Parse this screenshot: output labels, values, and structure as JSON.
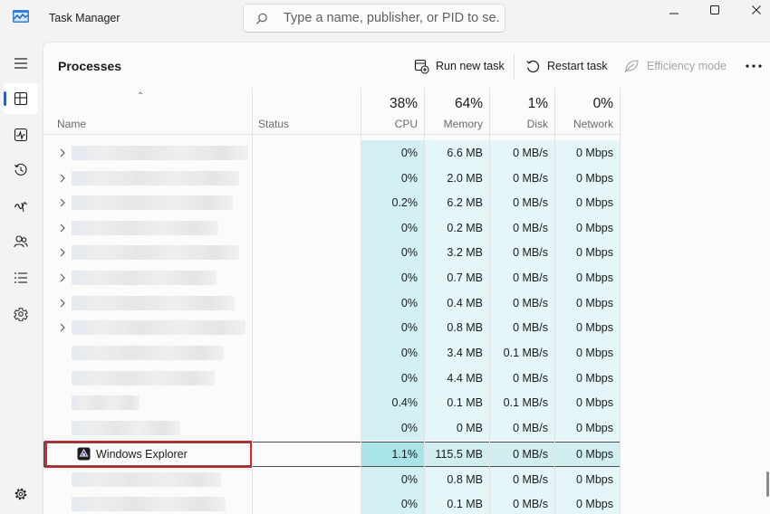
{
  "window": {
    "title": "Task Manager",
    "search_placeholder": "Type a name, publisher, or PID to se..."
  },
  "nav": [
    {
      "name": "hamburger-icon"
    },
    {
      "name": "processes-icon",
      "active": true
    },
    {
      "name": "performance-icon"
    },
    {
      "name": "app-history-icon"
    },
    {
      "name": "startup-apps-icon"
    },
    {
      "name": "users-icon"
    },
    {
      "name": "details-icon"
    },
    {
      "name": "services-icon"
    },
    {
      "name": "settings-icon"
    }
  ],
  "toolbar": {
    "page_title": "Processes",
    "run_new_task": "Run new task",
    "restart_task": "Restart task",
    "efficiency_mode": "Efficiency mode"
  },
  "columns": {
    "name": "Name",
    "status": "Status",
    "cpu_pct": "38%",
    "cpu": "CPU",
    "memory_pct": "64%",
    "memory": "Memory",
    "disk_pct": "1%",
    "disk": "Disk",
    "network_pct": "0%",
    "network": "Network"
  },
  "rows": [
    {
      "expandable": true,
      "cpu": "0%",
      "memory": "6.6 MB",
      "disk": "0 MB/s",
      "network": "0 Mbps"
    },
    {
      "expandable": true,
      "cpu": "0%",
      "memory": "2.0 MB",
      "disk": "0 MB/s",
      "network": "0 Mbps"
    },
    {
      "expandable": true,
      "cpu": "0.2%",
      "memory": "6.2 MB",
      "disk": "0 MB/s",
      "network": "0 Mbps"
    },
    {
      "expandable": true,
      "cpu": "0%",
      "memory": "0.2 MB",
      "disk": "0 MB/s",
      "network": "0 Mbps"
    },
    {
      "expandable": true,
      "cpu": "0%",
      "memory": "3.2 MB",
      "disk": "0 MB/s",
      "network": "0 Mbps"
    },
    {
      "expandable": true,
      "cpu": "0%",
      "memory": "0.7 MB",
      "disk": "0 MB/s",
      "network": "0 Mbps"
    },
    {
      "expandable": true,
      "cpu": "0%",
      "memory": "0.4 MB",
      "disk": "0 MB/s",
      "network": "0 Mbps"
    },
    {
      "expandable": true,
      "cpu": "0%",
      "memory": "0.8 MB",
      "disk": "0 MB/s",
      "network": "0 Mbps"
    },
    {
      "expandable": false,
      "cpu": "0%",
      "memory": "3.4 MB",
      "disk": "0.1 MB/s",
      "network": "0 Mbps"
    },
    {
      "expandable": false,
      "cpu": "0%",
      "memory": "4.4 MB",
      "disk": "0 MB/s",
      "network": "0 Mbps"
    },
    {
      "expandable": false,
      "cpu": "0.4%",
      "memory": "0.1 MB",
      "disk": "0.1 MB/s",
      "network": "0 Mbps"
    },
    {
      "expandable": false,
      "cpu": "0%",
      "memory": "0 MB",
      "disk": "0 MB/s",
      "network": "0 Mbps"
    },
    {
      "selected": true,
      "name": "Windows Explorer",
      "cpu": "1.1%",
      "memory": "115.5 MB",
      "disk": "0 MB/s",
      "network": "0 Mbps"
    },
    {
      "expandable": false,
      "cpu": "0%",
      "memory": "0.8 MB",
      "disk": "0 MB/s",
      "network": "0 Mbps"
    },
    {
      "expandable": false,
      "cpu": "0%",
      "memory": "0.1 MB",
      "disk": "0 MB/s",
      "network": "0 Mbps"
    }
  ]
}
